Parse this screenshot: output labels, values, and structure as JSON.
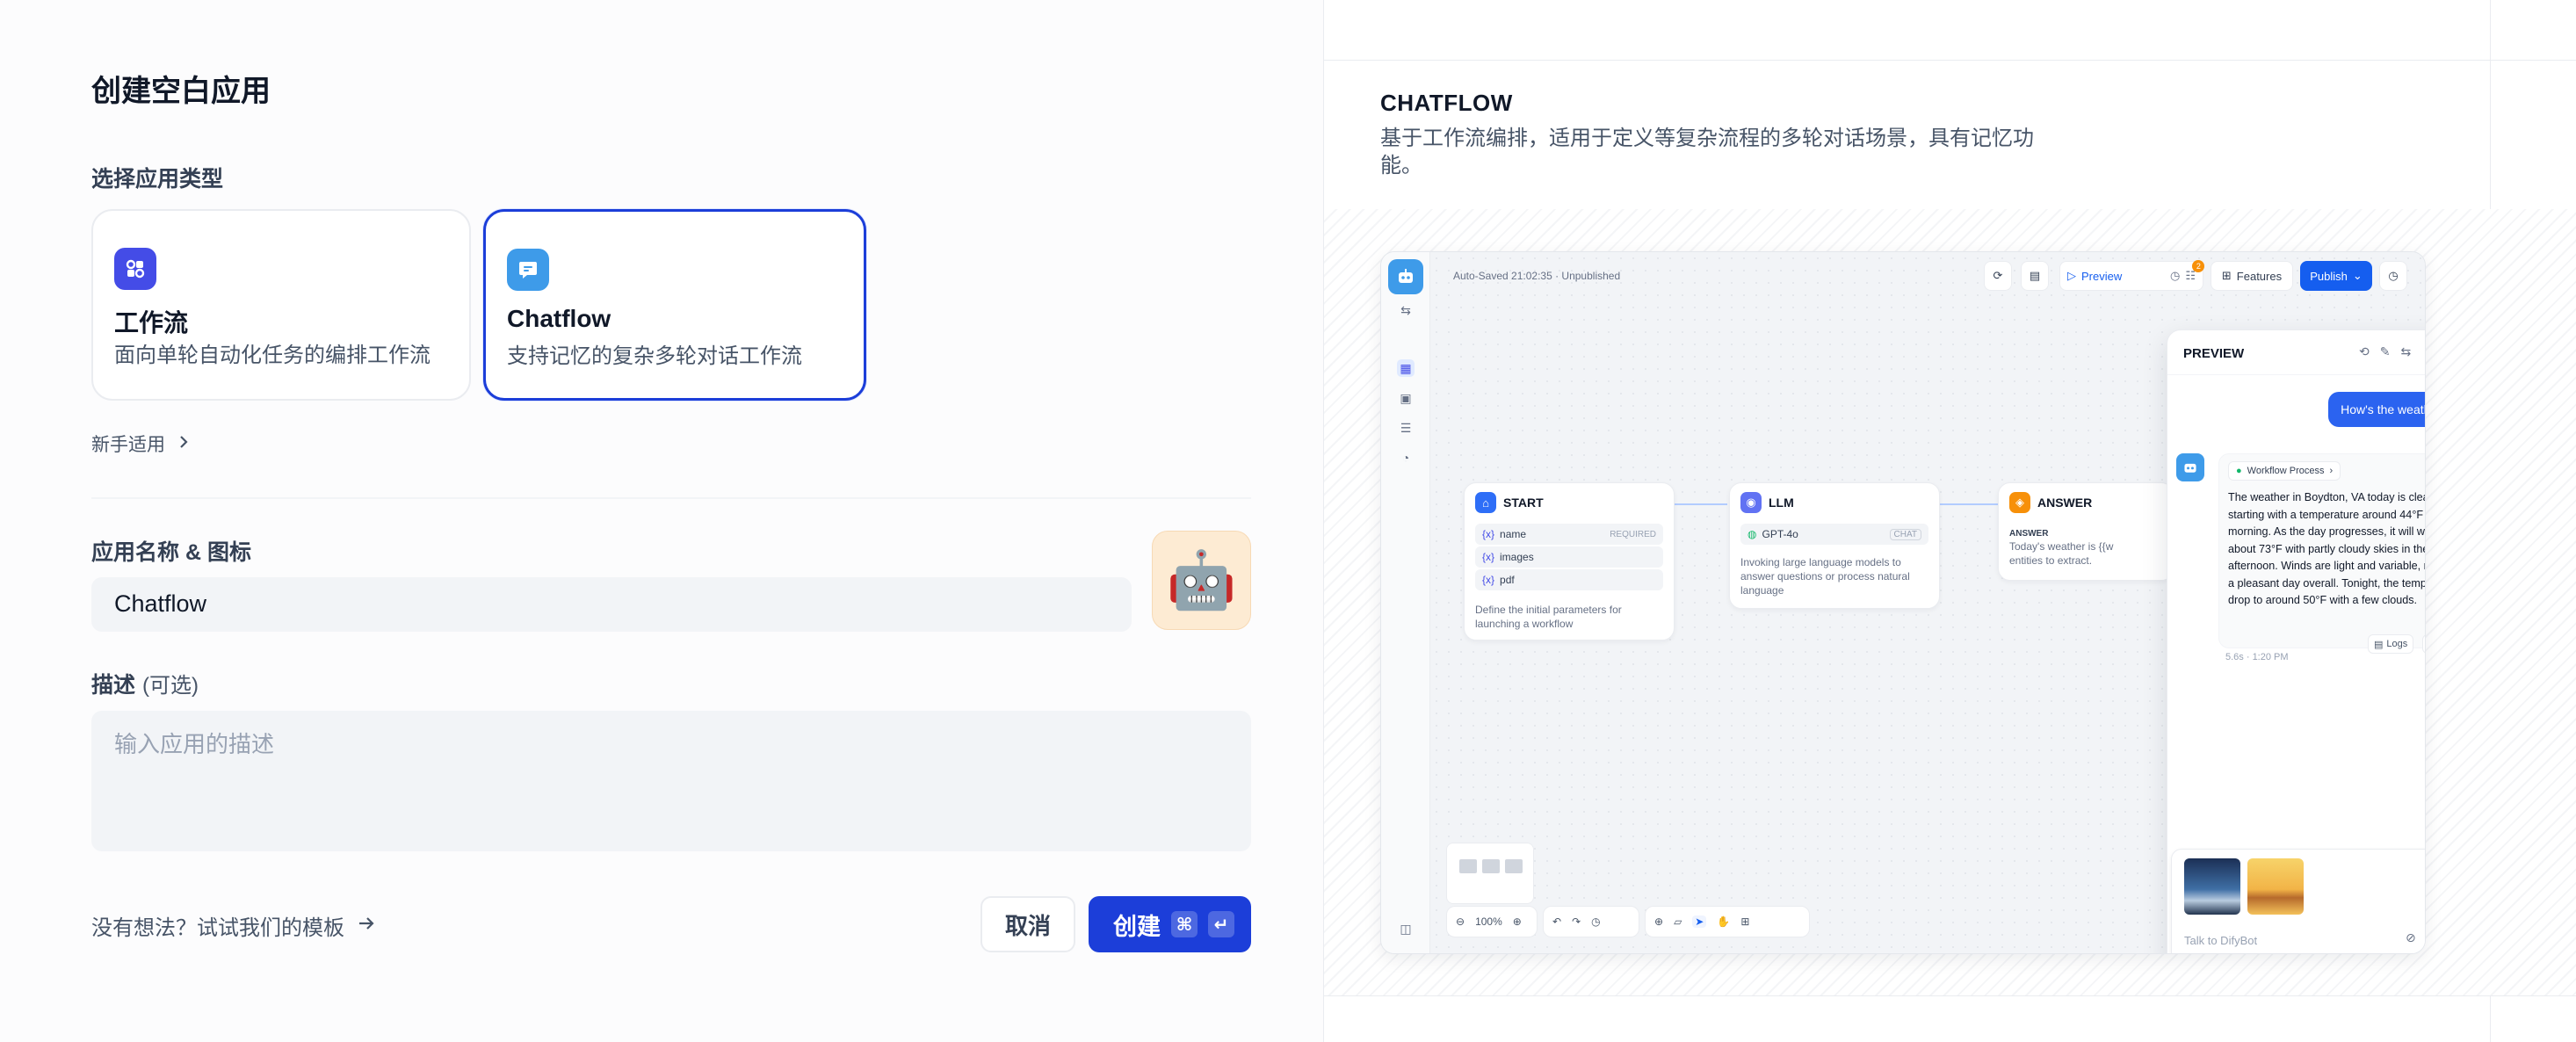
{
  "left": {
    "title": "创建空白应用",
    "type_section_label": "选择应用类型",
    "cards": [
      {
        "title": "工作流",
        "desc": "面向单轮自动化任务的编排工作流",
        "icon": "workflow-icon",
        "selected": false
      },
      {
        "title": "Chatflow",
        "desc": "支持记忆的复杂多轮对话工作流",
        "icon": "chatflow-icon",
        "selected": true
      }
    ],
    "beginner_link": "新手适用",
    "name_label": "应用名称 & 图标",
    "name_value": "Chatflow",
    "avatar_emoji": "🤖",
    "desc_label": "描述",
    "desc_optional": "(可选)",
    "desc_placeholder": "输入应用的描述",
    "template_link": "没有想法？试试我们的模板",
    "cancel": "取消",
    "create": "创建",
    "create_kbd1": "⌘",
    "create_kbd2": "↵",
    "accent": "#1c3ed9"
  },
  "right": {
    "heading": "CHATFLOW",
    "description": "基于工作流编排，适用于定义等复杂流程的多轮对话场景，具有记忆功能。",
    "preview": {
      "autosave": "Auto-Saved 21:02:35 · Unpublished",
      "toolbar": {
        "preview": "Preview",
        "badge": "2",
        "features": "Features",
        "publish": "Publish"
      },
      "nodes": {
        "start": {
          "title": "START",
          "vars": [
            {
              "name": "name",
              "tag": "REQUIRED"
            },
            {
              "name": "images",
              "tag": ""
            },
            {
              "name": "pdf",
              "tag": ""
            }
          ],
          "var_prefix": "{x}",
          "desc": "Define the initial parameters for launching a workflow"
        },
        "llm": {
          "title": "LLM",
          "model": "GPT-4o",
          "mode": "CHAT",
          "desc": "Invoking large language models to answer questions or process natural language"
        },
        "answer": {
          "title": "ANSWER",
          "label": "ANSWER",
          "text": "Today's weather is {{w",
          "text2": "entities to extract."
        }
      },
      "panel": {
        "title": "PREVIEW",
        "user_message": "How's the weather today",
        "process": "Workflow Process",
        "answer": "The weather in Boydton, VA today is clear and cool, starting with a temperature around 44°F in the morning. As the day progresses, it will warm up to about 73°F with partly cloudy skies in the afternoon. Winds are light and variable, making for a pleasant day overall. Tonight, the temperature will drop to around 50°F with a few clouds.",
        "meta": "5.6s · 1:20 PM",
        "logs": "Logs",
        "input_placeholder": "Talk to DifyBot"
      },
      "zoom": "100%"
    }
  }
}
